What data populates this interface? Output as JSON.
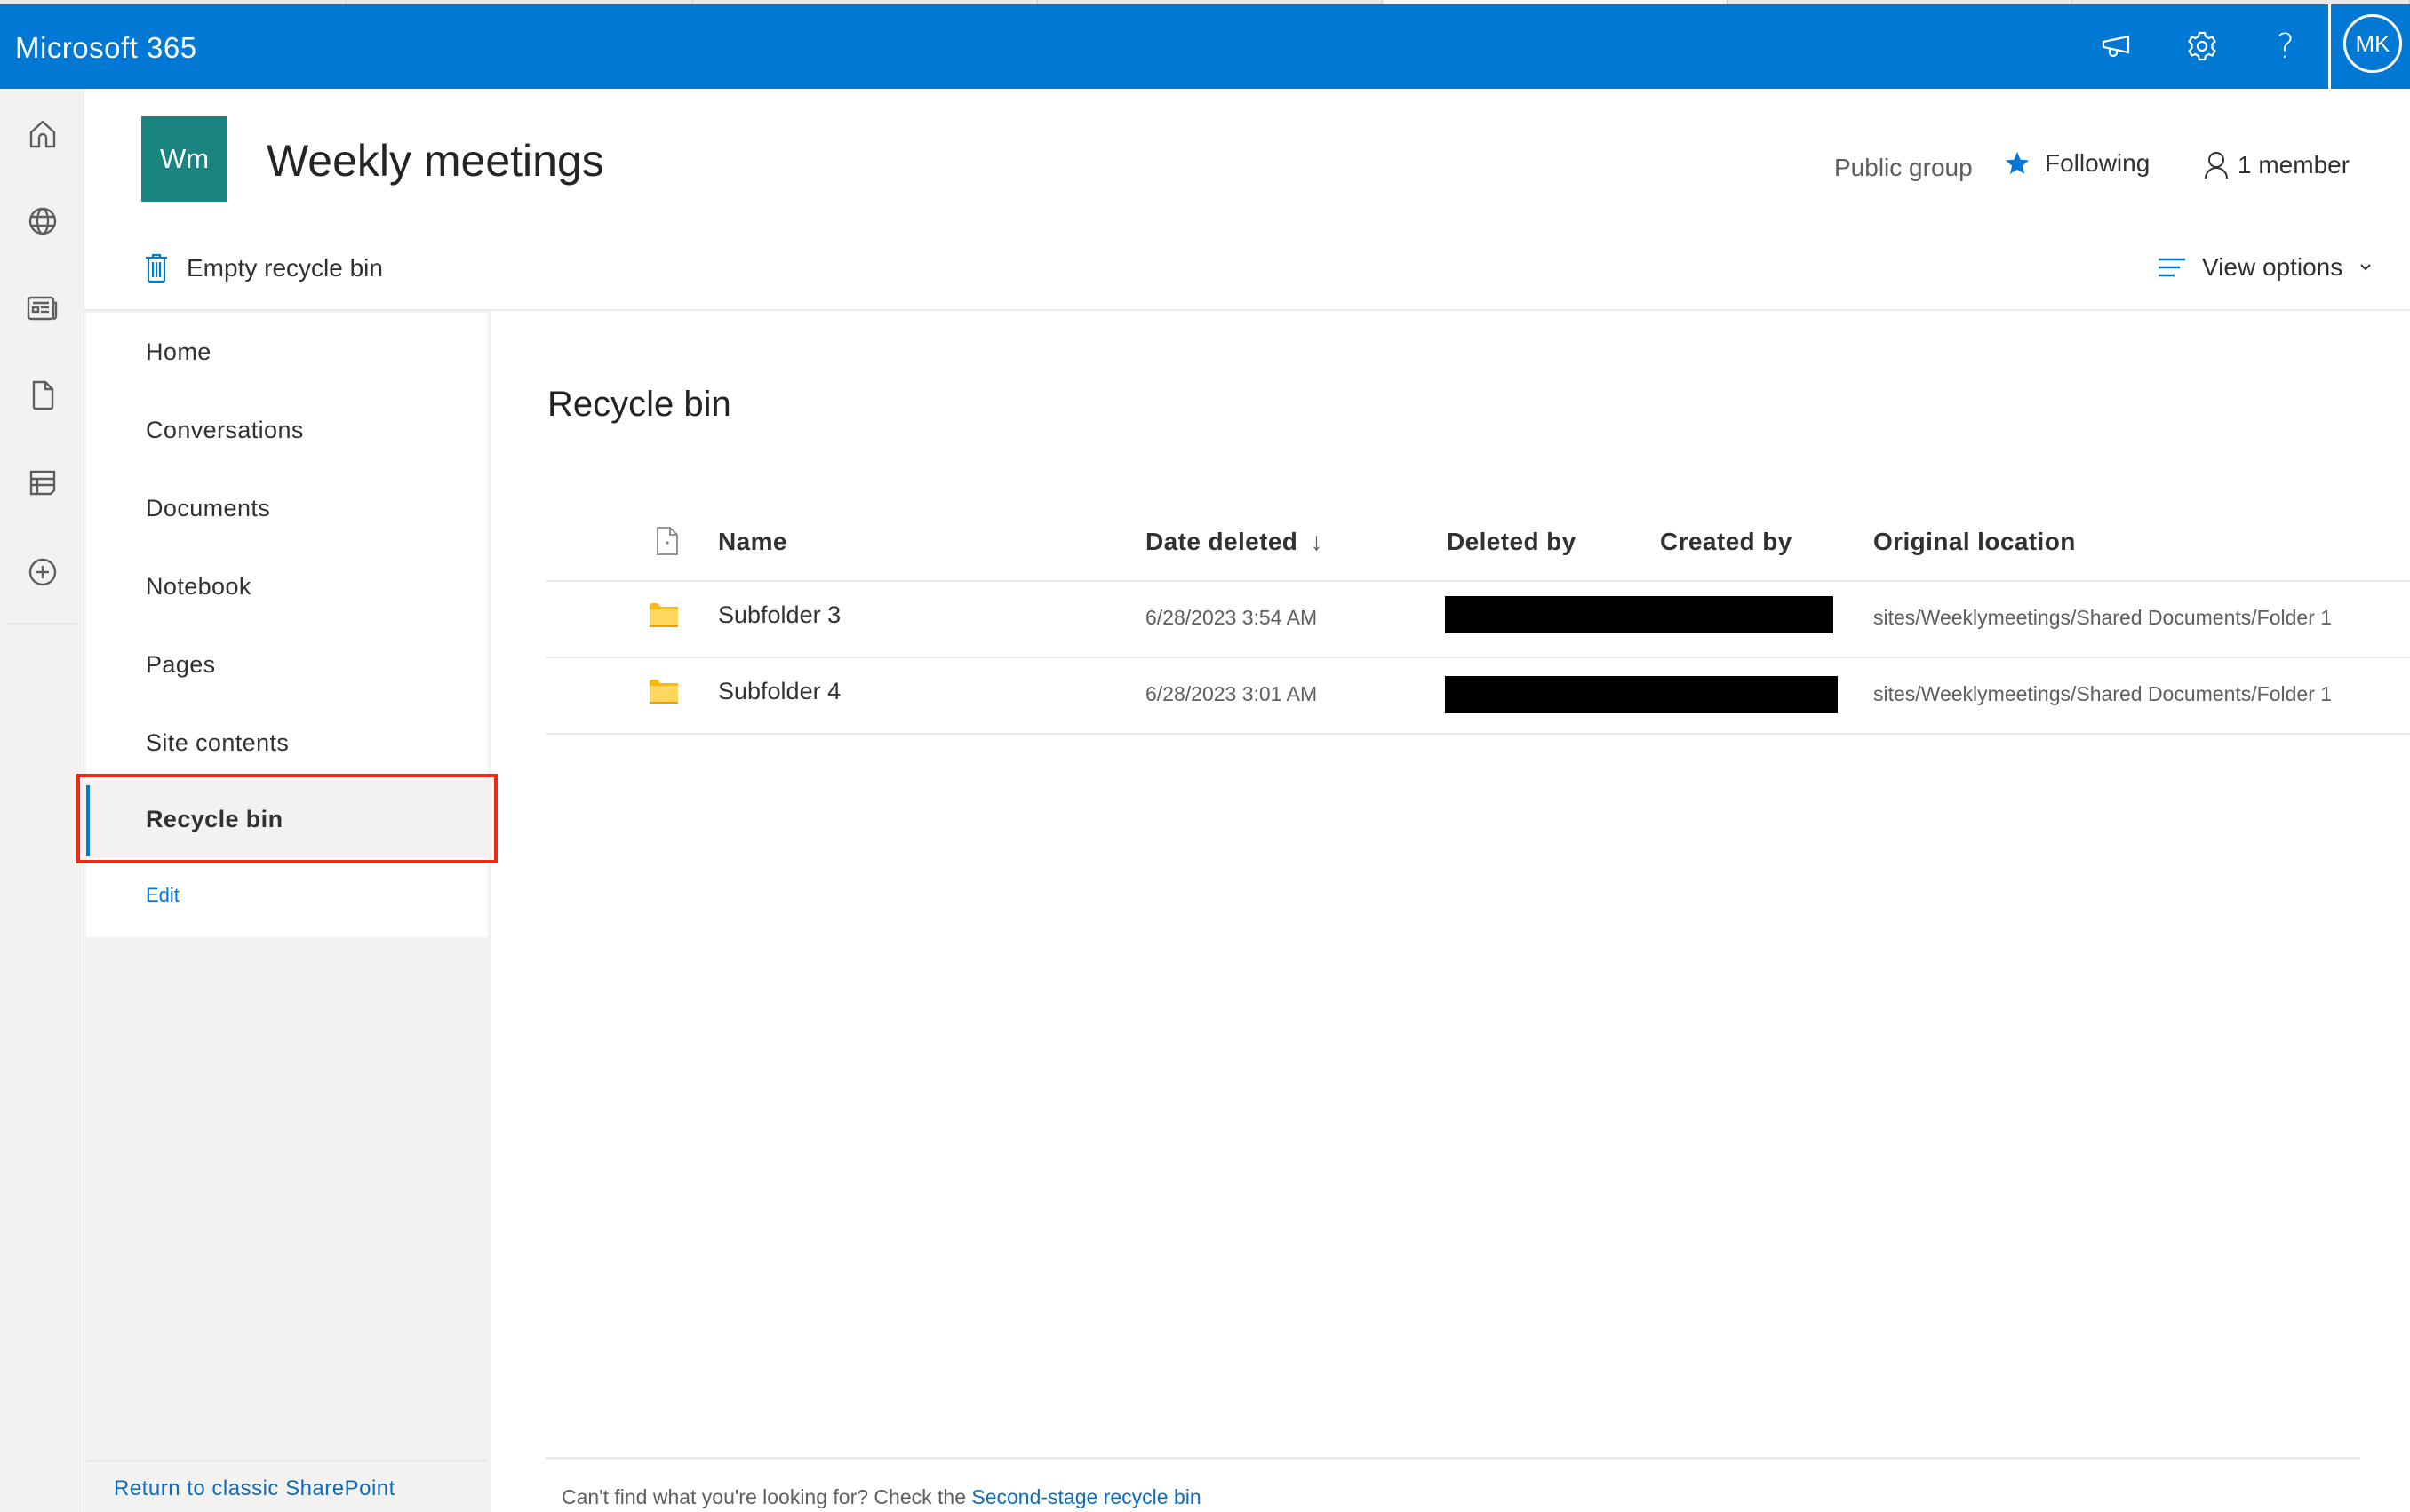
{
  "suite_header": {
    "brand": "Microsoft 365",
    "icons": [
      "megaphone-icon",
      "gear-icon",
      "help-icon"
    ],
    "help_glyph": "?",
    "avatar_initials": "MK",
    "accent_color": "#0078d4"
  },
  "app_rail": {
    "icons": [
      "home-icon",
      "globe-icon",
      "news-icon",
      "file-icon",
      "list-icon",
      "add-circle-icon"
    ]
  },
  "site_header": {
    "logo_initials": "Wm",
    "logo_color": "#1a8480",
    "title": "Weekly meetings",
    "privacy": "Public group",
    "following_label": "Following",
    "members_label": "1 member"
  },
  "command_bar": {
    "empty_recycle_bin": "Empty recycle bin",
    "view_options": "View options"
  },
  "left_nav": {
    "items": [
      {
        "label": "Home",
        "selected": false
      },
      {
        "label": "Conversations",
        "selected": false
      },
      {
        "label": "Documents",
        "selected": false
      },
      {
        "label": "Notebook",
        "selected": false
      },
      {
        "label": "Pages",
        "selected": false
      },
      {
        "label": "Site contents",
        "selected": false
      },
      {
        "label": "Recycle bin",
        "selected": true
      }
    ],
    "edit_label": "Edit",
    "return_classic": "Return to classic SharePoint"
  },
  "main": {
    "heading": "Recycle bin",
    "columns": {
      "name": "Name",
      "date_deleted": "Date deleted",
      "sort_indicator": "↓",
      "deleted_by": "Deleted by",
      "created_by": "Created by",
      "original_location": "Original location"
    },
    "rows": [
      {
        "name": "Subfolder 3",
        "date_deleted": "6/28/2023 3:54 AM",
        "deleted_by": "[redacted]",
        "created_by": "[redacted]",
        "original_location": "sites/Weeklymeetings/Shared Documents/Folder 1"
      },
      {
        "name": "Subfolder 4",
        "date_deleted": "6/28/2023 3:01 AM",
        "deleted_by": "[redacted]",
        "created_by": "[redacted]",
        "original_location": "sites/Weeklymeetings/Shared Documents/Folder 1"
      }
    ],
    "footer_text": "Can't find what you're looking for? Check the ",
    "footer_link": "Second-stage recycle bin"
  }
}
